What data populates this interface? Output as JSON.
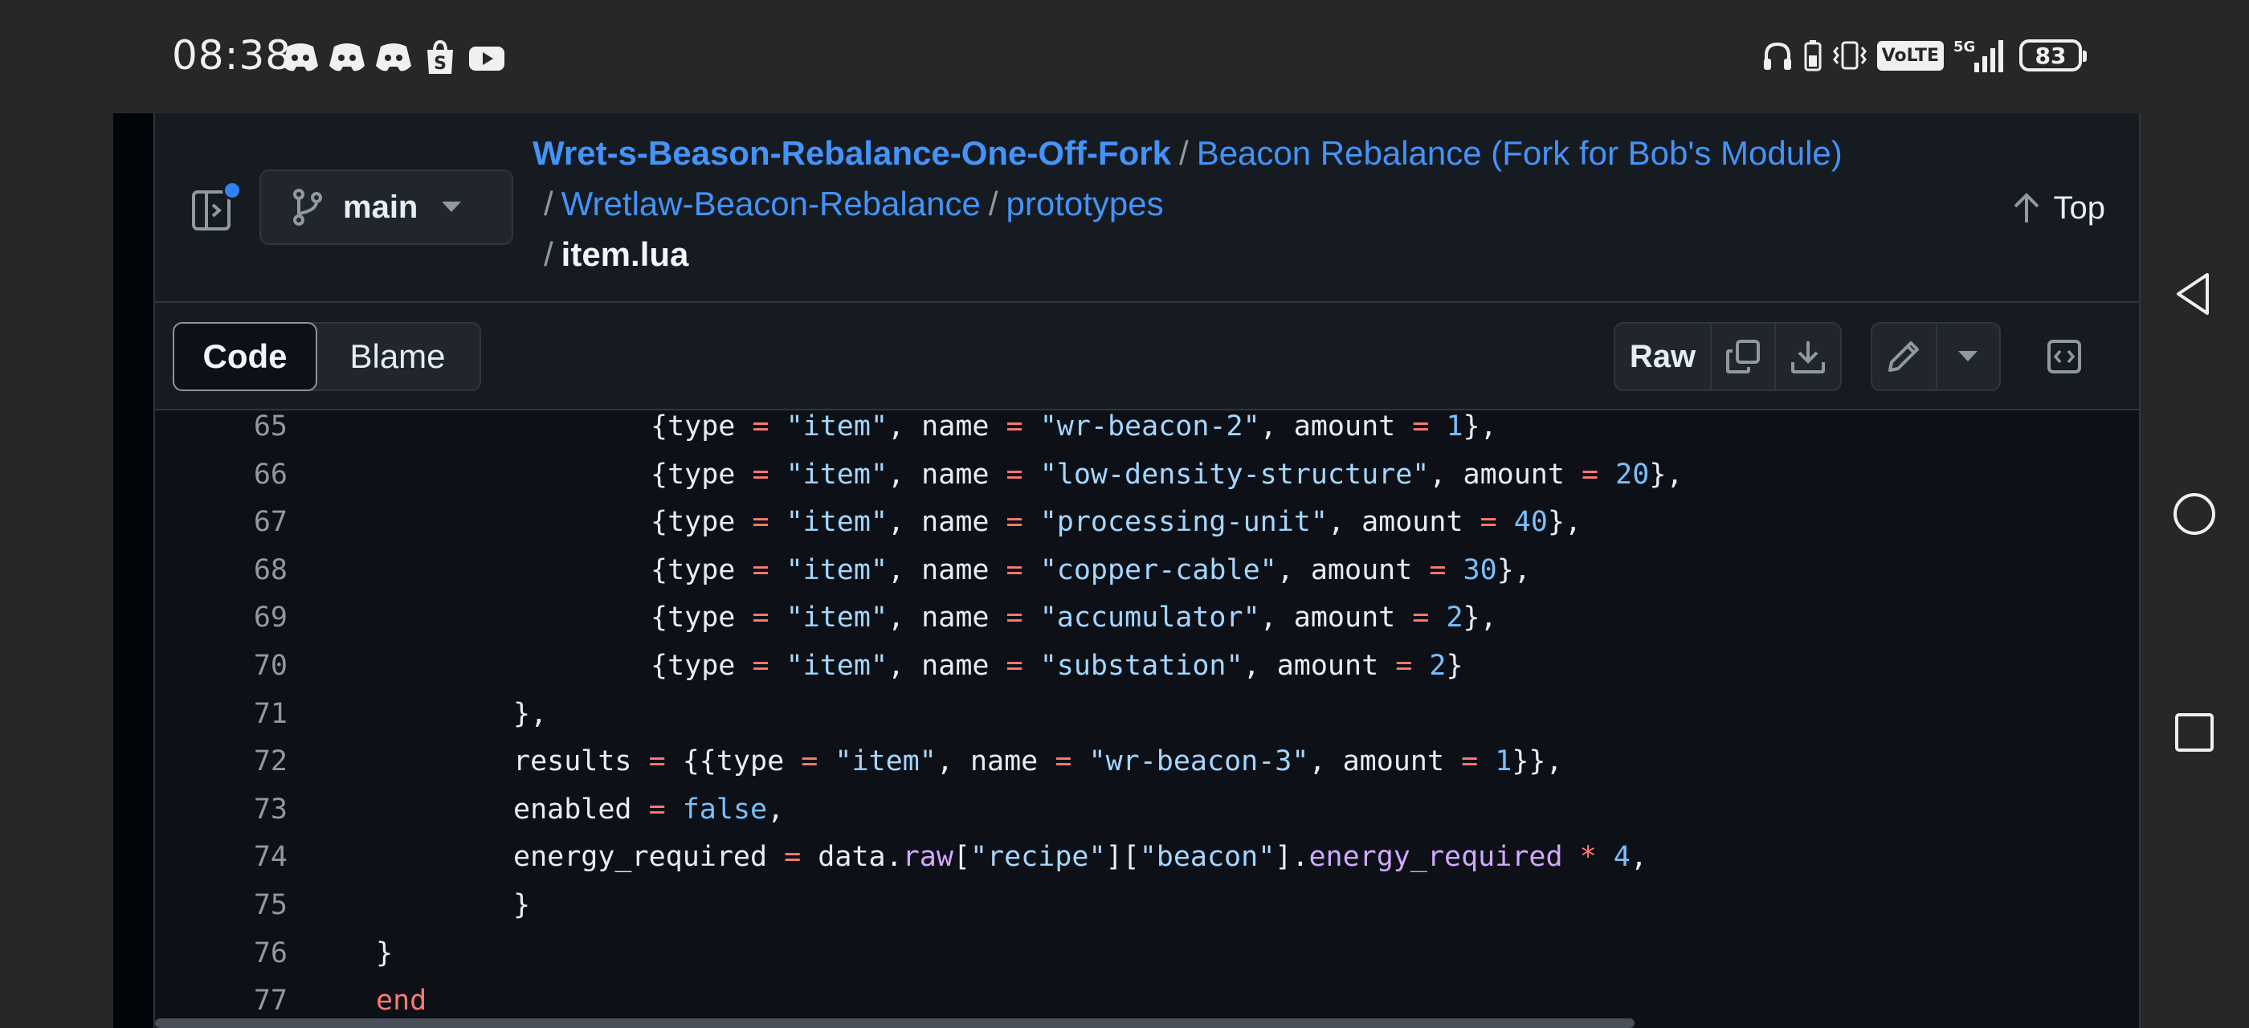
{
  "status_bar": {
    "time": "08:38",
    "battery": "83",
    "network": "5G",
    "volte": "VoLTE"
  },
  "header": {
    "branch": "main",
    "breadcrumb": {
      "repo": "Wret-s-Beason-Rebalance-One-Off-Fork",
      "sep": "/",
      "folder1": "Beacon Rebalance (Fork for Bob's Module)",
      "folder2": "Wretlaw-Beacon-Rebalance",
      "folder3": "prototypes",
      "file": "item.lua"
    },
    "top_label": "Top"
  },
  "toolbar": {
    "code_tab": "Code",
    "blame_tab": "Blame",
    "raw_label": "Raw"
  },
  "code": {
    "line_numbers": [
      "65",
      "66",
      "67",
      "68",
      "69",
      "70",
      "71",
      "72",
      "73",
      "74",
      "75",
      "76",
      "77"
    ]
  },
  "colors": {
    "link": "#4493f8",
    "keyword": "#ff7b72",
    "string": "#a5d6ff",
    "number": "#79c0ff",
    "function": "#d2a8ff"
  }
}
